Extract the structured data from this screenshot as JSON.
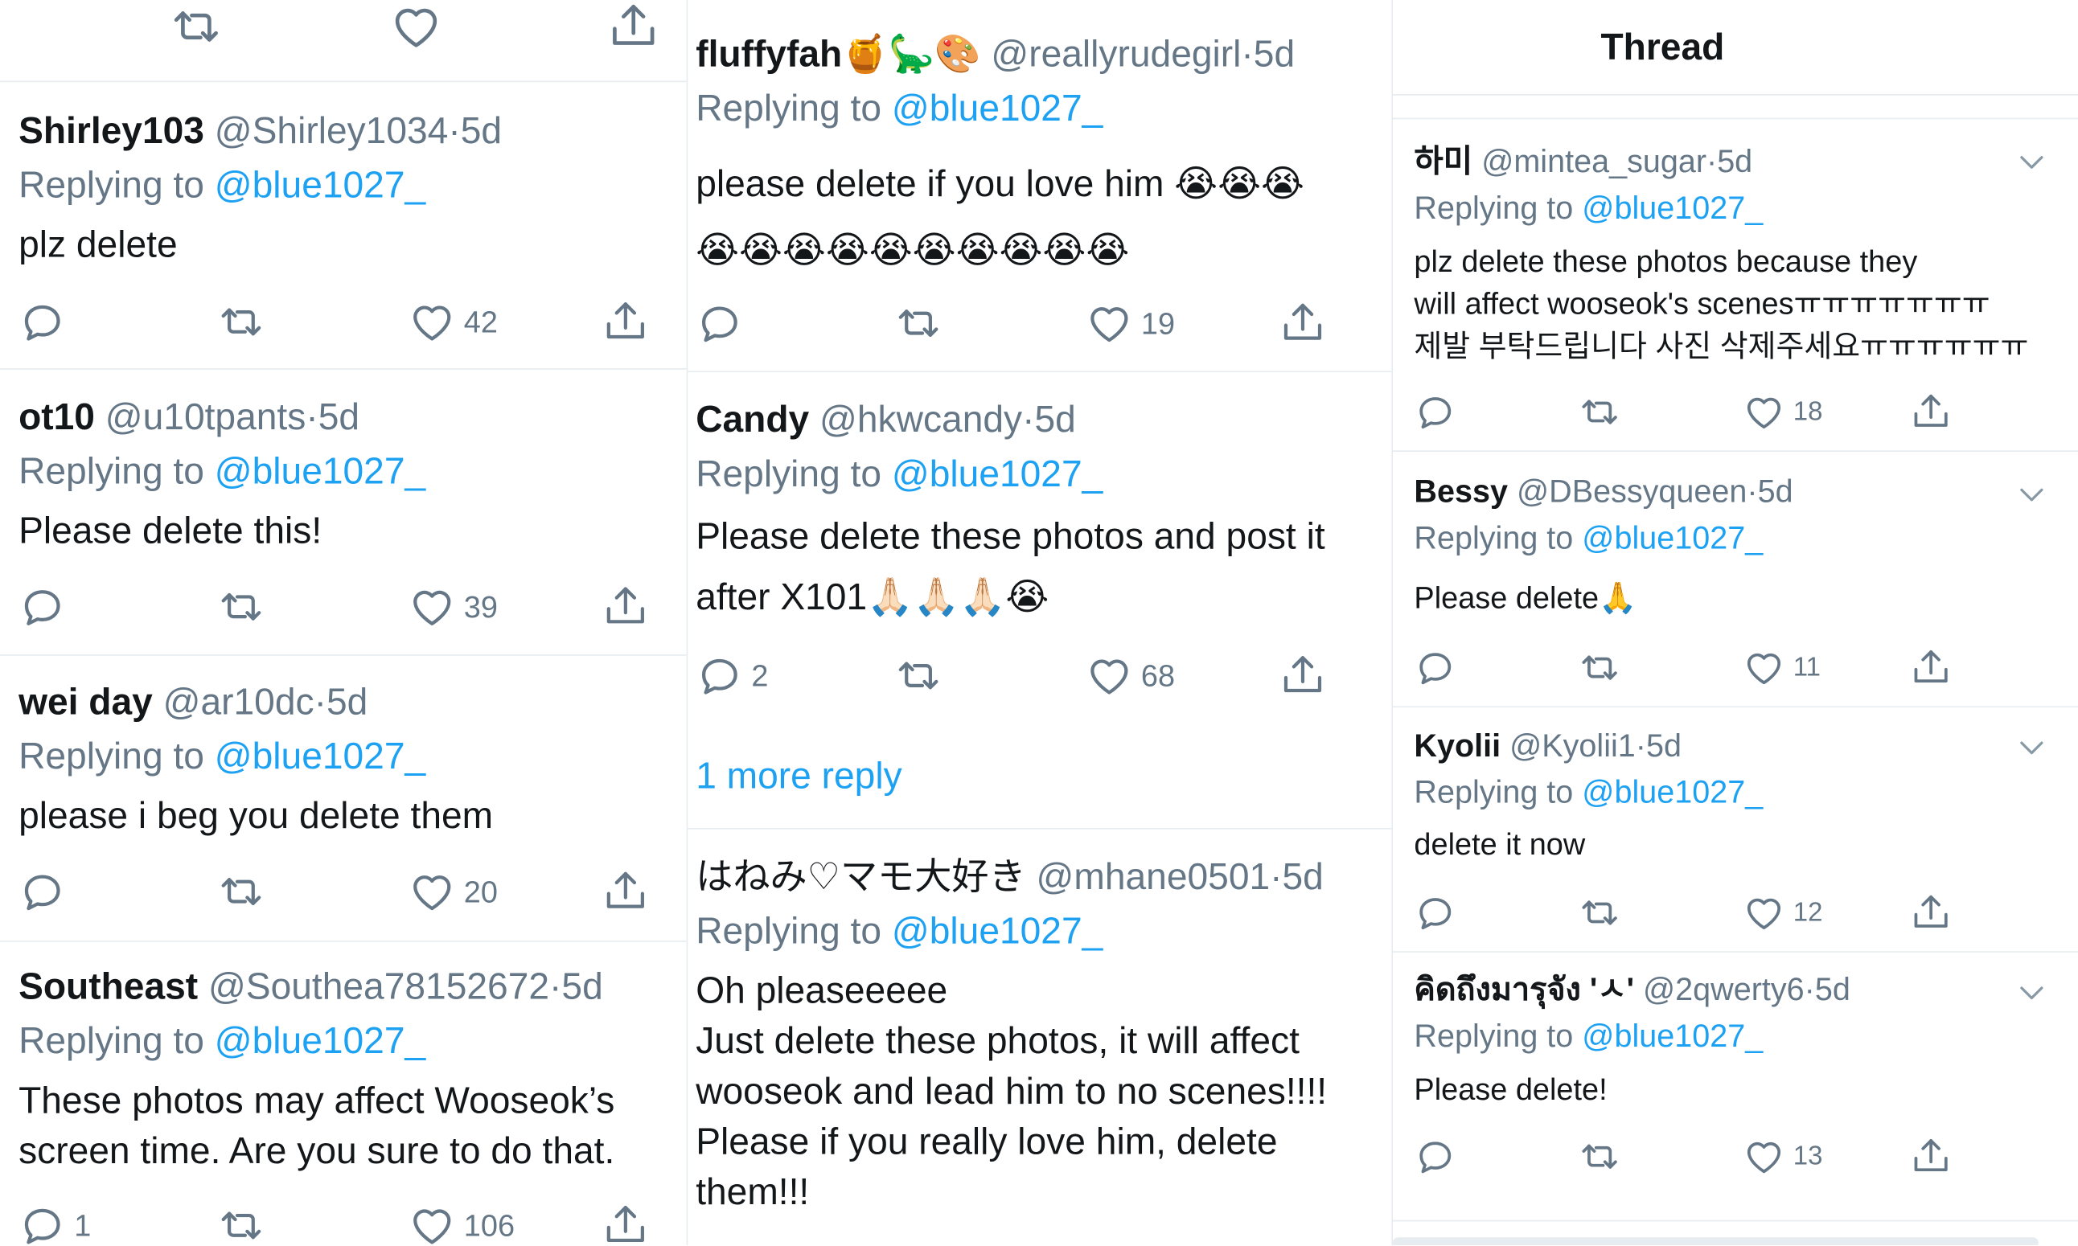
{
  "column1": {
    "top_actions": {
      "reply_count": "",
      "retweet_count": "",
      "like_count": ""
    },
    "tweets": [
      {
        "name": "Shirley103",
        "handle": "@Shirley1034",
        "sep": "·",
        "time": "5d",
        "reply_prefix": "Replying to",
        "reply_to": "@blue1027_",
        "text": "plz delete",
        "reply_count": "",
        "like_count": "42"
      },
      {
        "name": "ot10",
        "handle": "@u10tpants",
        "sep": "·",
        "time": "5d",
        "reply_prefix": "Replying to",
        "reply_to": "@blue1027_",
        "text": "Please delete this!",
        "reply_count": "",
        "like_count": "39"
      },
      {
        "name": "wei day",
        "handle": "@ar10dc",
        "sep": "·",
        "time": "5d",
        "reply_prefix": "Replying to",
        "reply_to": "@blue1027_",
        "text": "please i beg you delete them",
        "reply_count": "",
        "like_count": "20"
      },
      {
        "name": "Southeast",
        "handle": "@Southea78152672",
        "sep": "·",
        "time": "5d",
        "reply_prefix": "Replying to",
        "reply_to": "@blue1027_",
        "text": "These photos may affect Wooseok’s\nscreen time. Are you sure to do that.",
        "reply_count": "1",
        "like_count": "106"
      }
    ]
  },
  "column2": {
    "tweets": [
      {
        "name": "fluffyfah🍯🦕🎨",
        "handle": "@reallyrudegirl",
        "sep": "·",
        "time": "5d",
        "reply_prefix": "Replying to",
        "reply_to": "@blue1027_",
        "text": "please delete if you love him 😭😭😭\n😭😭😭😭😭😭😭😭😭😭",
        "reply_count": "",
        "like_count": "19"
      },
      {
        "name": "Candy",
        "handle": "@hkwcandy",
        "sep": "·",
        "time": "5d",
        "reply_prefix": "Replying to",
        "reply_to": "@blue1027_",
        "text": "Please delete these photos and post it\nafter X101🙏🏻🙏🏻🙏🏻😭",
        "reply_count": "2",
        "like_count": "68"
      },
      {
        "name": "はねみ♡マモ大好き",
        "handle": "@mhane0501",
        "sep": "·",
        "time": "5d",
        "reply_prefix": "Replying to",
        "reply_to": "@blue1027_",
        "text": "Oh pleaseeeee\nJust delete these photos, it will affect\nwooseok and lead him to no scenes!!!!\nPlease if you really love him, delete\nthem!!!",
        "reply_count": "",
        "like_count": ""
      }
    ],
    "more_replies": "1 more reply"
  },
  "column3": {
    "header_title": "Thread",
    "tweets": [
      {
        "name": "하미",
        "handle": "@mintea_sugar",
        "sep": "·",
        "time": "5d",
        "reply_prefix": "Replying to",
        "reply_to": "@blue1027_",
        "text": "plz delete these photos because they\nwill affect wooseok's scenesㅠㅠㅠㅠㅠㅠㅠ\n제발 부탁드립니다 사진 삭제주세요ㅠㅠㅠㅠㅠㅠ",
        "reply_count": "",
        "like_count": "18"
      },
      {
        "name": "Bessy",
        "handle": "@DBessyqueen",
        "sep": "·",
        "time": "5d",
        "reply_prefix": "Replying to",
        "reply_to": "@blue1027_",
        "text": "Please delete🙏",
        "reply_count": "",
        "like_count": "11"
      },
      {
        "name": "Kyolii",
        "handle": "@Kyolii1",
        "sep": "·",
        "time": "5d",
        "reply_prefix": "Replying to",
        "reply_to": "@blue1027_",
        "text": "delete it now",
        "reply_count": "",
        "like_count": "12"
      },
      {
        "name": "คิดถึงมารุจัง 'ㅅ'",
        "handle": "@2qwerty6",
        "sep": "·",
        "time": "5d",
        "reply_prefix": "Replying to",
        "reply_to": "@blue1027_",
        "text": "Please delete!",
        "reply_count": "",
        "like_count": "13"
      }
    ]
  },
  "colors": {
    "link_blue": "#1da1f2",
    "secondary_text": "#657786",
    "divider": "#e6ecf0",
    "primary_text": "#14171a"
  },
  "icons": [
    "reply-icon",
    "retweet-icon",
    "like-icon",
    "share-icon",
    "chevron-down-icon"
  ]
}
